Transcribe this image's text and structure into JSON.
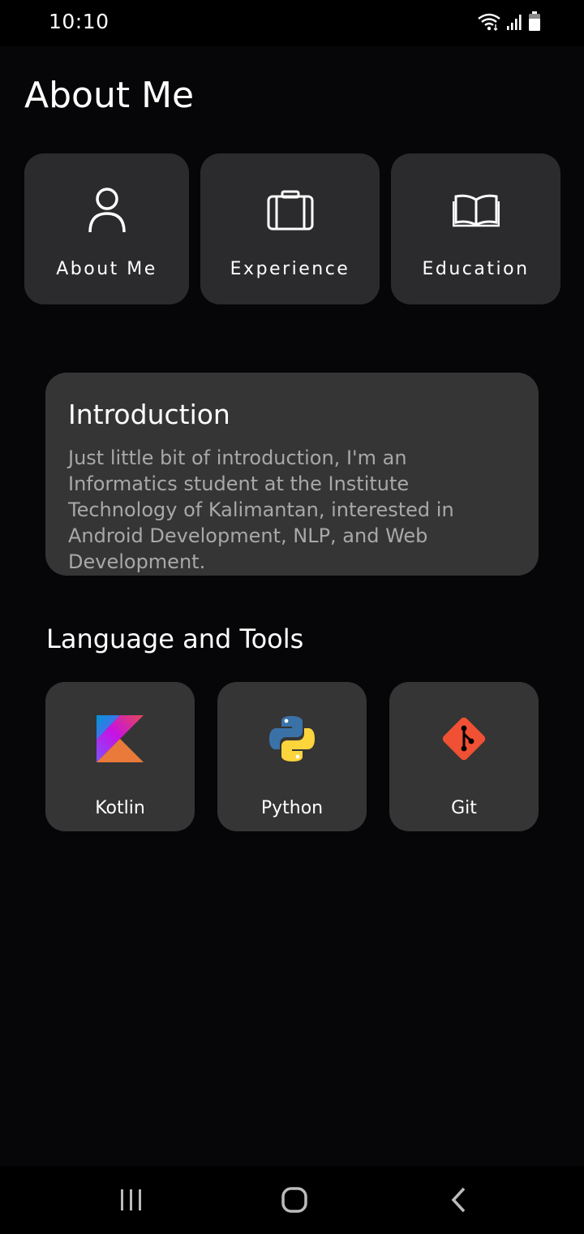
{
  "status_bar": {
    "time": "10:10",
    "icons": [
      "wifi-icon",
      "signal-icon",
      "battery-icon"
    ]
  },
  "page": {
    "title": "About Me"
  },
  "nav_cards": [
    {
      "label": "About Me",
      "icon": "person-icon"
    },
    {
      "label": "Experience",
      "icon": "briefcase-icon"
    },
    {
      "label": "Education",
      "icon": "book-icon"
    }
  ],
  "introduction": {
    "title": "Introduction",
    "body": "Just little bit of introduction, I'm an Informatics student at the Institute Technology of Kalimantan, interested in Android Development, NLP, and Web Development."
  },
  "tools": {
    "title": "Language and Tools",
    "items": [
      {
        "label": "Kotlin",
        "icon": "kotlin-logo"
      },
      {
        "label": "Python",
        "icon": "python-logo"
      },
      {
        "label": "Git",
        "icon": "git-logo"
      }
    ]
  },
  "system_nav": {
    "buttons": [
      "recents-icon",
      "home-icon",
      "back-icon"
    ]
  },
  "colors": {
    "background": "#060609",
    "card": "#2b2b2d",
    "intro_card": "#353535",
    "muted_text": "#a8a8a8",
    "git_red": "#f05033"
  }
}
